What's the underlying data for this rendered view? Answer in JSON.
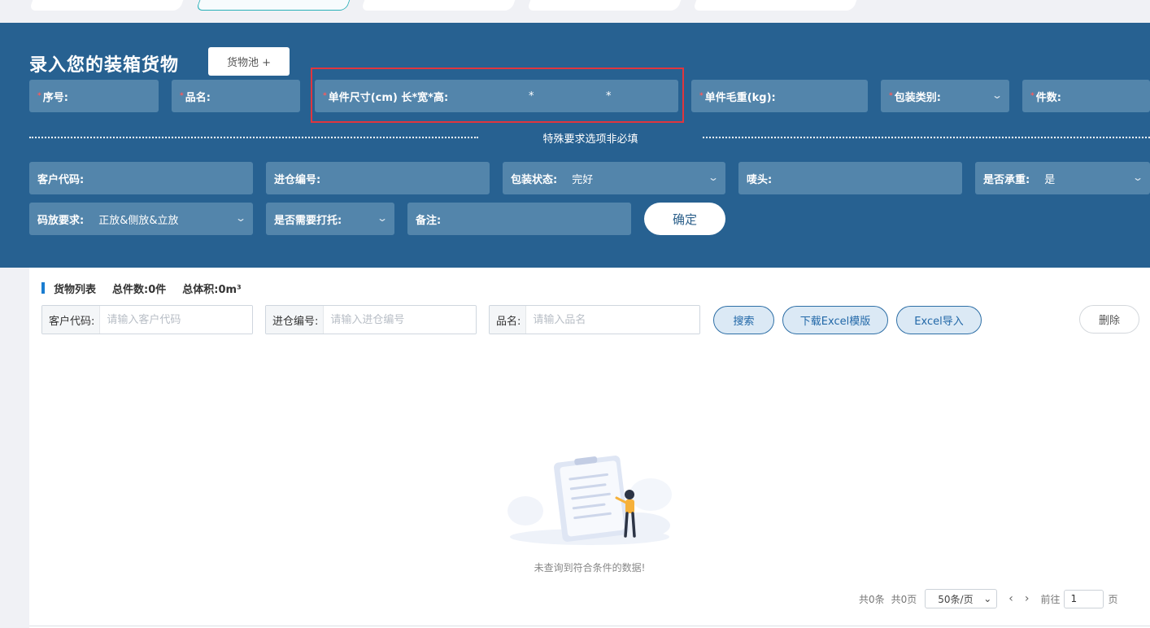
{
  "form": {
    "title": "录入您的装箱货物",
    "pool_button": "货物池 +",
    "required_mark": "*",
    "required_fields": {
      "seq_no": "序号:",
      "product_name": "品名:",
      "unit_size": "单件尺寸(cm) 长*宽*高:",
      "size_sep_1": "*",
      "size_sep_2": "*",
      "unit_weight": "单件毛重(kg):",
      "package_type": "包装类别:",
      "pieces": "件数:"
    },
    "divider_text": "特殊要求选项非必填",
    "optional_fields": {
      "customer_code": "客户代码:",
      "inbound_no": "进仓编号:",
      "package_status_label": "包装状态:",
      "package_status_value": "完好",
      "mark": "唛头:",
      "load_bearing_label": "是否承重:",
      "load_bearing_value": "是",
      "stacking_label": "码放要求:",
      "stacking_value": "正放&侧放&立放",
      "pallet_label": "是否需要打托:",
      "remark": "备注:"
    },
    "confirm_button": "确定"
  },
  "list": {
    "title": "货物列表",
    "total_pieces": "总件数:0件",
    "total_volume": "总体积:0m³",
    "search": {
      "customer_code_label": "客户代码:",
      "customer_code_placeholder": "请输入客户代码",
      "inbound_no_label": "进仓编号:",
      "inbound_no_placeholder": "请输入进仓编号",
      "product_name_label": "品名:",
      "product_name_placeholder": "请输入品名"
    },
    "buttons": {
      "search": "搜索",
      "download_template": "下载Excel模版",
      "import_excel": "Excel导入",
      "delete": "删除"
    },
    "empty_text": "未查询到符合条件的数据!",
    "pagination": {
      "total_items": "共0条",
      "total_pages": "共0页",
      "page_size": "50条/页",
      "goto_label": "前往",
      "page_input": "1",
      "page_unit": "页"
    }
  },
  "colors": {
    "form_bg": "#276191",
    "field_bg": "#5385ab",
    "highlight_box": "#e0363e",
    "accent": "#1a7dd1"
  }
}
